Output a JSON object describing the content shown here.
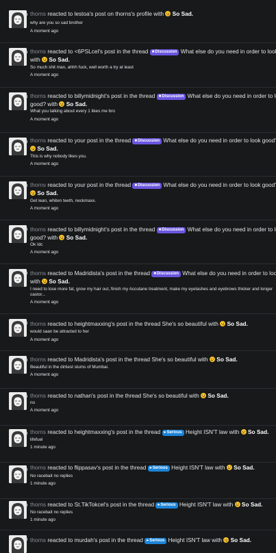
{
  "common": {
    "reacted_label": "So Sad.",
    "reaction_icon": "sad-emoji",
    "badge_discussion": "Discussion",
    "badge_serious": "Serious"
  },
  "alerts": [
    {
      "user": "thorns",
      "pre": "reacted to lestoa's post on thorns's profile with",
      "snippet": "why are you so sad brother",
      "time": "A moment ago"
    },
    {
      "user": "thorns",
      "pre": "reacted to <6PSLcel's post in the thread",
      "badge": "Discussion",
      "title": "What else do you need in order to look",
      "line2_pre": "with",
      "snippet": "So much shit man, ahhh fuck, well worth a try at least",
      "time": "A moment ago"
    },
    {
      "user": "thorns",
      "pre": "reacted to billymidnight's post in the thread",
      "badge": "Discussion",
      "title": "What else do you need in order to lo",
      "line2_pre": "good? with",
      "snippet": "What you talking about every 1 likes me bro",
      "time": "A moment ago"
    },
    {
      "user": "thorns",
      "pre": "reacted to your post in the thread",
      "badge": "Discussion",
      "title": "What else do you need in order to look good?",
      "line2_pre": "",
      "snippet": "This is why nobody likes you.",
      "time": "A moment ago"
    },
    {
      "user": "thorns",
      "pre": "reacted to your post in the thread",
      "badge": "Discussion",
      "title": "What else do you need in order to look good?",
      "line2_pre": "",
      "snippet": "Get lean, whiten teeth, neckmaxx.",
      "time": "A moment ago"
    },
    {
      "user": "thorns",
      "pre": "reacted to billymidnight's post in the thread",
      "badge": "Discussion",
      "title": "What else do you need in order to lo",
      "line2_pre": "good? with",
      "snippet": "Ok Idc",
      "time": "A moment ago"
    },
    {
      "user": "thorns",
      "pre": "reacted to Madridista's post in the thread",
      "badge": "Discussion",
      "title": "What else do you need in order to look",
      "line2_pre": "with",
      "snippet": "I need to lose more fat, grow my hair out, finish my Accutane treatment, make my eyelashes and eyebrows thicker and longer",
      "snippet2": "castor...",
      "time": "A moment ago"
    },
    {
      "user": "thorns",
      "pre": "reacted to heightmaxxing's post in the thread",
      "title": "She's so beautiful",
      "post": "with",
      "snippet": "would saan be attracted to her",
      "time": "A moment ago"
    },
    {
      "user": "thorns",
      "pre": "reacted to Madridista's post in the thread",
      "title": "She's so beautiful",
      "post": "with",
      "snippet": "Beautiful in the dirtiest slums of Mumbai.",
      "time": "A moment ago"
    },
    {
      "user": "thorns",
      "pre": "reacted to nathan's post in the thread",
      "title": "She's so beautiful",
      "post": "with",
      "snippet": "no",
      "time": "A moment ago"
    },
    {
      "user": "thorns",
      "pre": "reacted to heightmaxxing's post in the thread",
      "badge": "Serious",
      "title": "Height ISN'T law",
      "post": "with",
      "snippet": "lifefuel",
      "time": "1 minute ago"
    },
    {
      "user": "thorns",
      "pre": "reacted to flippasav's post in the thread",
      "badge": "Serious",
      "title": "Height ISN'T law",
      "post": "with",
      "snippet": "No racebait no replies",
      "time": "1 minute ago"
    },
    {
      "user": "thorns",
      "pre": "reacted to St.TikTokcel's post in the thread",
      "badge": "Serious",
      "title": "Height ISN'T law",
      "post": "with",
      "snippet": "No racebait no replies",
      "time": "1 minute ago"
    },
    {
      "user": "thorns",
      "pre": "reacted to murdah's post in the thread",
      "badge": "Serious",
      "title": "Height ISN'T law",
      "post": "with"
    }
  ]
}
